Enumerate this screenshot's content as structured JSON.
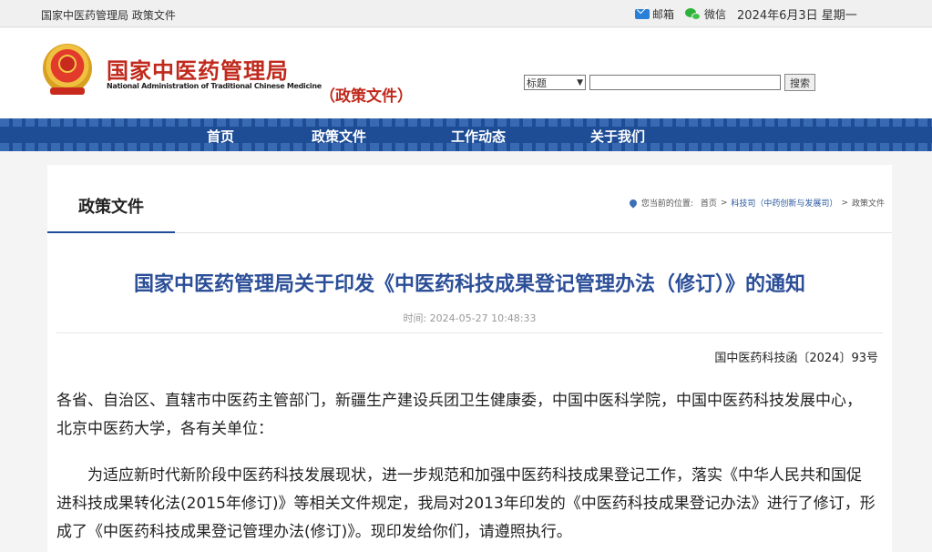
{
  "topbar": {
    "site_label": "国家中医药管理局 政策文件",
    "mail_label": "邮箱",
    "wechat_label": "微信",
    "date": "2024年6月3日 星期一"
  },
  "header": {
    "org_name_cn": "国家中医药管理局",
    "org_name_en": "National Administration of Traditional Chinese Medicine",
    "site_subtitle": "（政策文件）",
    "search": {
      "select_value": "标题",
      "button_label": "搜索"
    }
  },
  "nav": {
    "items": [
      {
        "label": "首页"
      },
      {
        "label": "政策文件"
      },
      {
        "label": "工作动态"
      },
      {
        "label": "关于我们"
      }
    ]
  },
  "section": {
    "title": "政策文件"
  },
  "breadcrumb": {
    "prefix": "您当前的位置:",
    "items": [
      "首页",
      "科技司（中药创新与发展司）",
      "政策文件"
    ],
    "separator": ">"
  },
  "article": {
    "title": "国家中医药管理局关于印发《中医药科技成果登记管理办法（修订）》的通知",
    "time": "时间:  2024-05-27 10:48:33",
    "doc_number": "国中医药科技函〔2024〕93号",
    "paragraphs": [
      "各省、自治区、直辖市中医药主管部门，新疆生产建设兵团卫生健康委，中国中医科学院，中国中医药科技发展中心，北京中医药大学，各有关单位：",
      "为适应新时代新阶段中医药科技发展现状，进一步规范和加强中医药科技成果登记工作，落实《中华人民共和国促进科技成果转化法(2015年修订)》等相关文件规定，我局对2013年印发的《中医药科技成果登记办法》进行了修订，形成了《中医药科技成果登记管理办法(修订)》。现印发给你们，请遵照执行。"
    ]
  }
}
